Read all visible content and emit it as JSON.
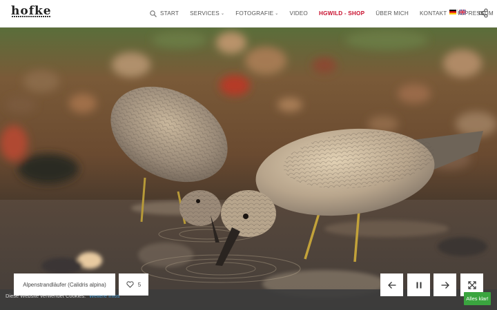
{
  "header": {
    "logo_text": "hofke",
    "nav": {
      "start": "START",
      "services": "SERVICES",
      "fotografie": "FOTOGRAFIE",
      "video": "VIDEO",
      "shop": "HGWILD - SHOP",
      "ueber": "ÜBER MICH",
      "kontakt": "KONTAKT",
      "impressum": "IMPRESSUM"
    },
    "flag_separator": "|",
    "icons": {
      "search": "search-icon",
      "share": "share-icon",
      "flag_de": "flag-de-icon",
      "flag_en": "flag-en-icon"
    },
    "accent_color": "#c8102e"
  },
  "gallery": {
    "caption": "Alpenstrandläufer (Calidris alpina)",
    "likes": "5",
    "controls": [
      "arrow-left-icon",
      "pause-icon",
      "arrow-right-icon",
      "fullscreen-icon"
    ]
  },
  "cookie": {
    "text": "Diese Website verwendet Cookies.",
    "link": "Weitere Infos",
    "button": "Alles klar!",
    "button_color": "#3aa53f"
  }
}
